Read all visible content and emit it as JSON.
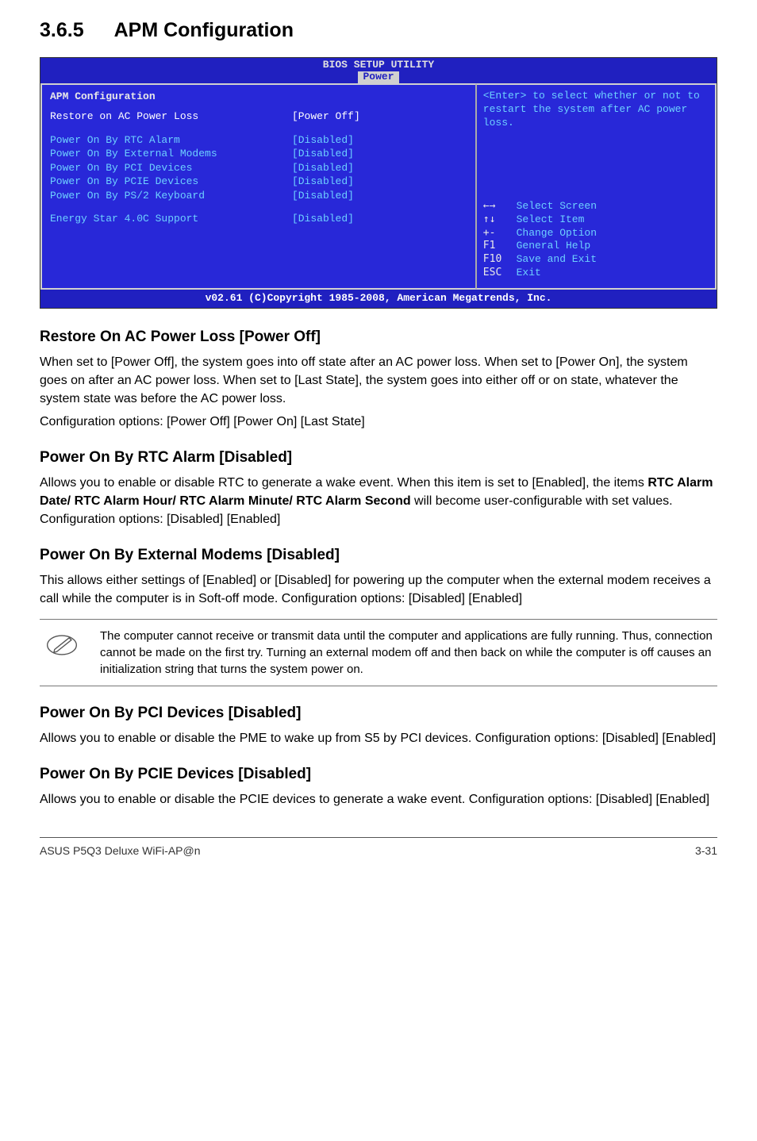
{
  "section": {
    "number": "3.6.5",
    "title": "APM Configuration"
  },
  "bios": {
    "setup_title": "BIOS SETUP UTILITY",
    "tab": "Power",
    "panel_title": "APM Configuration",
    "rows": [
      {
        "label": "Restore on AC Power Loss",
        "value": "[Power Off]",
        "selected": true,
        "gap_after": true
      },
      {
        "label": "Power On By RTC Alarm",
        "value": "[Disabled]"
      },
      {
        "label": "Power On By External Modems",
        "value": "[Disabled]"
      },
      {
        "label": "Power On By PCI Devices",
        "value": "[Disabled]"
      },
      {
        "label": "Power On By PCIE Devices",
        "value": "[Disabled]"
      },
      {
        "label": "Power On By PS/2 Keyboard",
        "value": "[Disabled]",
        "gap_after": true
      },
      {
        "label": "Energy Star 4.0C Support",
        "value": "[Disabled]"
      }
    ],
    "help_text": "<Enter> to select whether or not to restart the system after AC power loss.",
    "keys": [
      {
        "key": "←→",
        "desc": "Select Screen",
        "icon": "arrows-lr"
      },
      {
        "key": "↑↓",
        "desc": "Select Item",
        "icon": "arrows-ud"
      },
      {
        "key": "+-",
        "desc": "Change Option"
      },
      {
        "key": "F1",
        "desc": "General Help"
      },
      {
        "key": "F10",
        "desc": "Save and Exit"
      },
      {
        "key": "ESC",
        "desc": "Exit"
      }
    ],
    "footer": "v02.61 (C)Copyright 1985-2008, American Megatrends, Inc."
  },
  "subsections": [
    {
      "heading": "Restore On AC Power Loss [Power Off]",
      "paragraphs": [
        "When set to [Power Off], the system goes into off state after an AC power loss. When set to [Power On], the system goes on after an AC power loss. When set to [Last State], the system goes into either off or on state, whatever the system state was before the AC power loss.",
        "Configuration options: [Power Off] [Power On] [Last State]"
      ]
    },
    {
      "heading": "Power On By RTC Alarm [Disabled]",
      "paragraphs_html": [
        "Allows you to enable or disable RTC to generate a wake event. When this item is set to [Enabled], the items <b>RTC Alarm Date/ RTC Alarm Hour/ RTC Alarm Minute/ RTC Alarm Second</b> will become user-configurable with set values. Configuration options: [Disabled] [Enabled]"
      ]
    },
    {
      "heading": "Power On By External Modems [Disabled]",
      "paragraphs": [
        "This allows either settings of [Enabled] or [Disabled] for powering up the computer when the external modem receives a call while the computer is in Soft-off mode. Configuration options: [Disabled] [Enabled]"
      ],
      "note": "The computer cannot receive or transmit data until the computer and applications are fully running. Thus, connection cannot be made on the first try. Turning an external modem off and then back on while the computer is off causes an initialization string that turns the system power on."
    },
    {
      "heading": "Power On By PCI Devices [Disabled]",
      "paragraphs": [
        "Allows you to enable or disable the PME to wake up from S5 by PCI devices. Configuration options: [Disabled] [Enabled]"
      ]
    },
    {
      "heading": "Power On By PCIE Devices [Disabled]",
      "paragraphs": [
        "Allows you to enable or disable the PCIE devices to generate a wake event. Configuration options: [Disabled] [Enabled]"
      ]
    }
  ],
  "footer": {
    "left": "ASUS P5Q3 Deluxe WiFi-AP@n",
    "right": "3-31"
  }
}
